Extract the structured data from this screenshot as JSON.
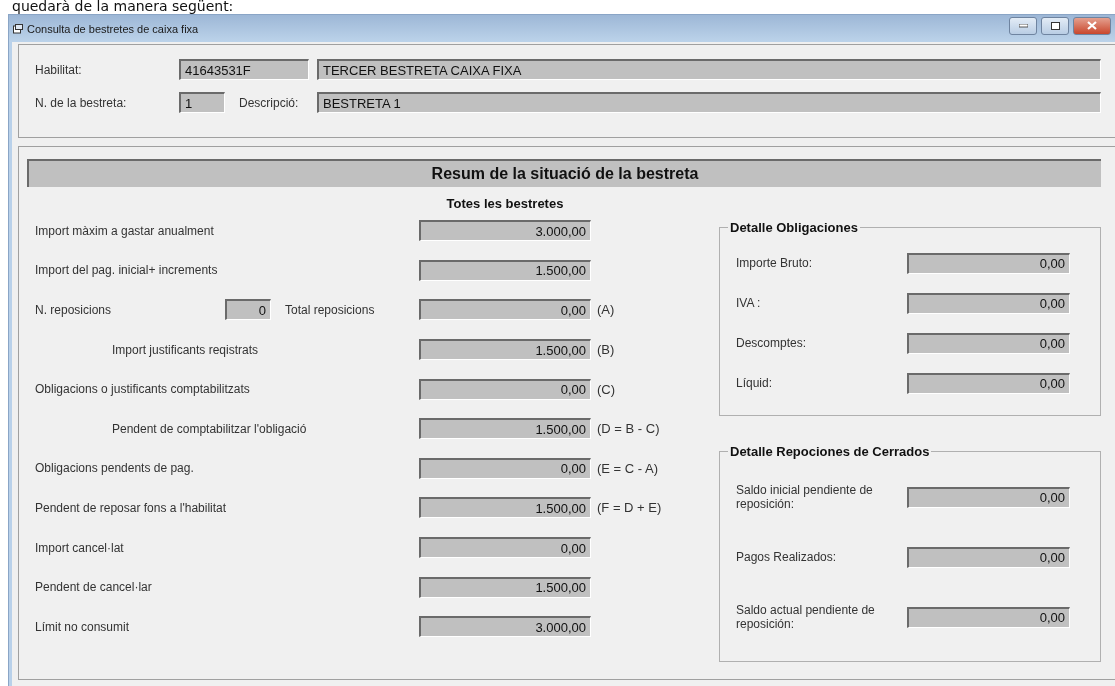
{
  "document_text": "quedarà de la manera següent:",
  "window": {
    "title": "Consulta de bestretes de caixa fixa"
  },
  "header": {
    "habilitat_label": "Habilitat:",
    "habilitat_code": "41643531F",
    "habilitat_name": "TERCER BESTRETA CAIXA FIXA",
    "number_label": "N. de la bestreta:",
    "number": "1",
    "description_label": "Descripció:",
    "description": "BESTRETA 1"
  },
  "summary": {
    "title": "Resum de la situació de la bestreta",
    "column_heading": "Totes les bestretes",
    "rows": [
      {
        "kind": "plain",
        "label": "Import màxim a gastar anualment",
        "value": "3.000,00"
      },
      {
        "kind": "plain",
        "label": "Import del pag. inicial+ increments",
        "value": "1.500,00"
      },
      {
        "kind": "count",
        "label": "N. reposicions",
        "count": "0",
        "label_2": "Total reposicions",
        "value": "0,00",
        "suffix": "(A)"
      },
      {
        "kind": "indented",
        "label": "Import justificants reqistrats",
        "value": "1.500,00",
        "suffix": "(B)"
      },
      {
        "kind": "plain",
        "label": "Obligacions o justificants comptabilitzats",
        "value": "0,00",
        "suffix": "(C)"
      },
      {
        "kind": "indented",
        "label": "Pendent de comptabilitzar l'obligació",
        "value": "1.500,00",
        "suffix": "(D = B - C)"
      },
      {
        "kind": "plain",
        "label": "Obligacions pendents de pag.",
        "value": "0,00",
        "suffix": "(E = C - A)"
      },
      {
        "kind": "plain",
        "label": "Pendent de reposar fons a l'habilitat",
        "value": "1.500,00",
        "suffix": "(F = D + E)"
      },
      {
        "kind": "plain",
        "label": "Import cancel·lat",
        "value": "0,00"
      },
      {
        "kind": "plain",
        "label": "Pendent de cancel·lar",
        "value": "1.500,00"
      },
      {
        "kind": "plain",
        "label": "Límit no consumit",
        "value": "3.000,00"
      }
    ]
  },
  "groups": [
    {
      "title": "Detalle Obligaciones",
      "fields": [
        {
          "label": "Importe Bruto:",
          "value": "0,00"
        },
        {
          "label": "IVA :",
          "value": "0,00"
        },
        {
          "label": "Descomptes:",
          "value": "0,00"
        },
        {
          "label": "Líquid:",
          "value": "0,00"
        }
      ]
    },
    {
      "title": "Detalle Repociones de Cerrados",
      "fields": [
        {
          "label": "Saldo inicial pendiente de reposición:",
          "value": "0,00"
        },
        {
          "label": "Pagos Realizados:",
          "value": "0,00"
        },
        {
          "label": "Saldo actual pendiente de reposición:",
          "value": "0,00"
        }
      ]
    }
  ]
}
